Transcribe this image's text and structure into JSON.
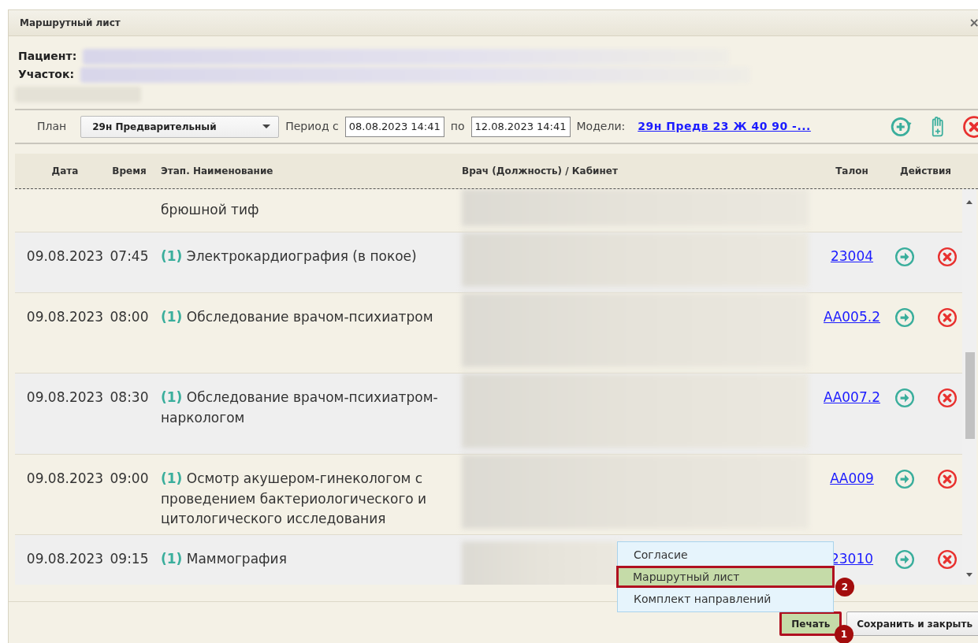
{
  "window": {
    "title": "Маршрутный лист",
    "close": "×"
  },
  "patient": {
    "label": "Пациент:"
  },
  "district": {
    "label": "Участок:"
  },
  "toolbar": {
    "plan_label": "План",
    "plan_value": "29н Предварительный",
    "period_label": "Период с",
    "from": "08.08.2023 14:41",
    "to_label": "по",
    "to": "12.08.2023 14:41",
    "models_label": "Модели:",
    "models_link": "29н Предв 23 Ж 40 90 -..."
  },
  "table": {
    "columns": [
      "Дата",
      "Время",
      "Этап. Наименование",
      "Врач (Должность) / Кабинет",
      "Талон",
      "Действия"
    ],
    "rows": [
      {
        "kind": "partial",
        "name": "брюшной тиф"
      },
      {
        "kind": "full",
        "date": "09.08.2023",
        "time": "07:45",
        "stage": "(1)",
        "name": "Электрокардиография (в покое)",
        "talon": "23004"
      },
      {
        "kind": "full",
        "date": "09.08.2023",
        "time": "08:00",
        "stage": "(1)",
        "name": "Обследование врачом-психиатром",
        "talon": "АА005.2"
      },
      {
        "kind": "full",
        "date": "09.08.2023",
        "time": "08:30",
        "stage": "(1)",
        "name": "Обследование врачом-психиатром-наркологом",
        "talon": "АА007.2"
      },
      {
        "kind": "full",
        "date": "09.08.2023",
        "time": "09:00",
        "stage": "(1)",
        "name": "Осмотр акушером-гинекологом с проведением бактериологического и цитологического исследования",
        "talon": "АА009"
      },
      {
        "kind": "full",
        "date": "09.08.2023",
        "time": "09:15",
        "stage": "(1)",
        "name": "Маммография",
        "talon": "23010"
      }
    ]
  },
  "menu": {
    "items": [
      {
        "label": "Согласие",
        "selected": false
      },
      {
        "label": "Маршрутный лист",
        "selected": true,
        "marker": "2"
      },
      {
        "label": "Комплект направлений",
        "selected": false
      }
    ]
  },
  "buttons": [
    {
      "label": "Печать",
      "selected": true,
      "marker": "1"
    },
    {
      "label": "Сохранить и закрыть",
      "selected": false
    }
  ]
}
